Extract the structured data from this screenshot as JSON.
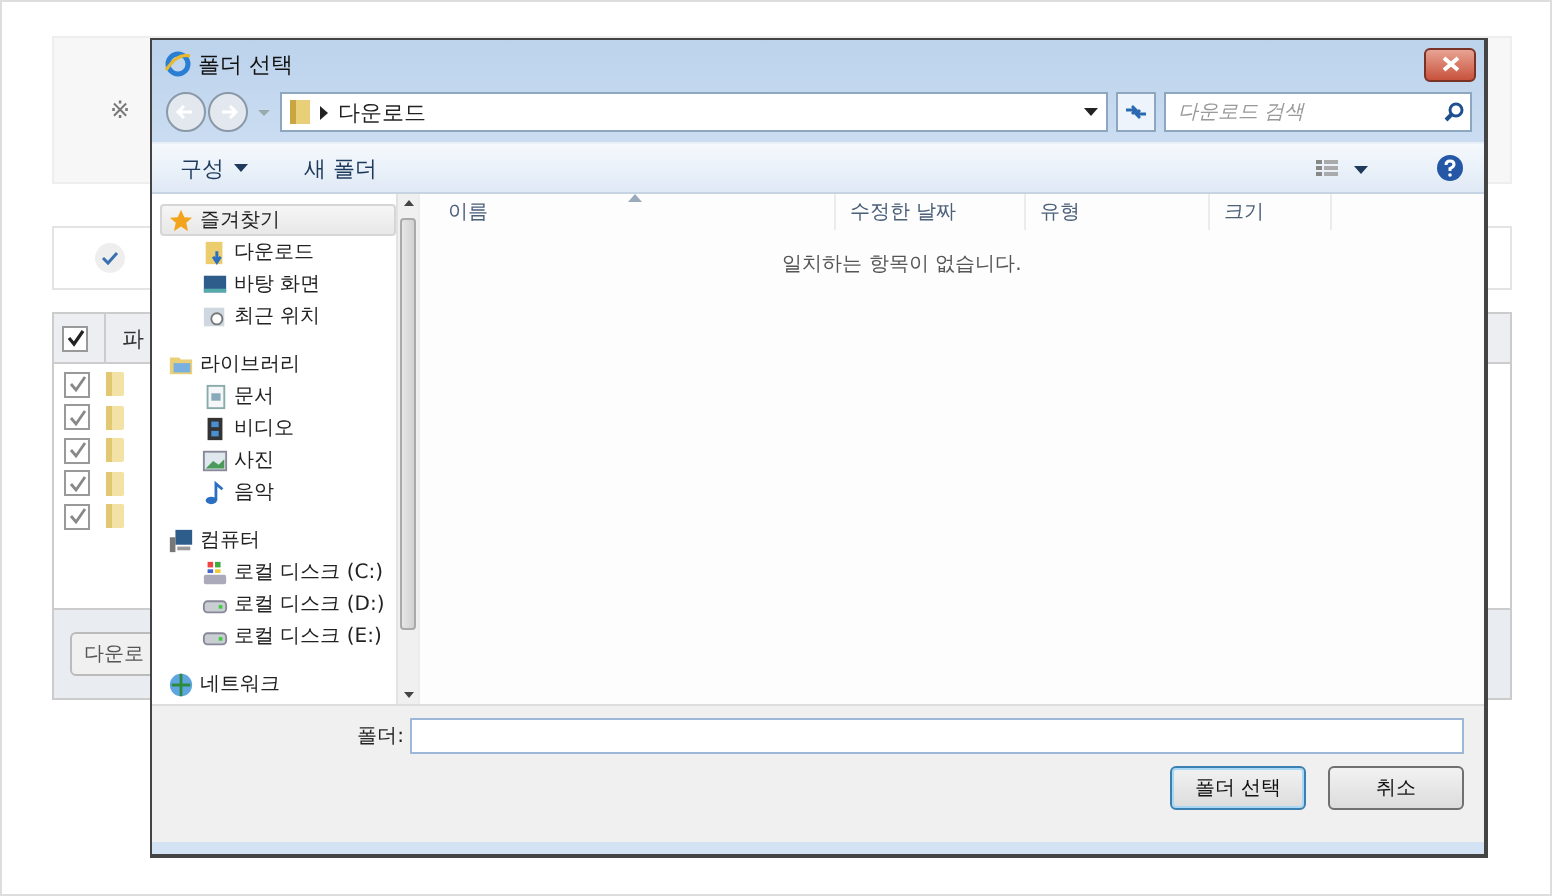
{
  "background_page": {
    "notice": "※",
    "table": {
      "header_checked": true,
      "columns": [
        "파"
      ],
      "rows": [
        {
          "checked": true
        },
        {
          "checked": true
        },
        {
          "checked": true
        },
        {
          "checked": true
        },
        {
          "checked": true
        }
      ]
    },
    "button": "다운로"
  },
  "dialog": {
    "title": "폴더 선택",
    "address": {
      "path": "다운로드"
    },
    "search": {
      "placeholder": "다운로드 검색"
    },
    "toolbar": [
      {
        "label": "구성",
        "kind": "menu"
      },
      {
        "label": "새 폴더",
        "kind": "button"
      }
    ],
    "nav": [
      {
        "label": "즐겨찾기",
        "kind": "favorites",
        "selected": true,
        "children": [
          {
            "label": "다운로드",
            "kind": "downloads",
            "selected": false
          },
          {
            "label": "바탕 화면",
            "kind": "desktop",
            "selected": false
          },
          {
            "label": "최근 위치",
            "kind": "recent",
            "selected": false
          }
        ]
      },
      {
        "label": "라이브러리",
        "kind": "library",
        "selected": false,
        "children": [
          {
            "label": "문서",
            "kind": "documents",
            "selected": false
          },
          {
            "label": "비디오",
            "kind": "video",
            "selected": false
          },
          {
            "label": "사진",
            "kind": "pictures",
            "selected": false
          },
          {
            "label": "음악",
            "kind": "music",
            "selected": false
          }
        ]
      },
      {
        "label": "컴퓨터",
        "kind": "computer",
        "selected": false,
        "children": [
          {
            "label": "로컬 디스크 (C:)",
            "kind": "system-drive",
            "selected": false
          },
          {
            "label": "로컬 디스크 (D:)",
            "kind": "drive",
            "selected": false
          },
          {
            "label": "로컬 디스크 (E:)",
            "kind": "drive",
            "selected": false
          }
        ]
      },
      {
        "label": "네트워크",
        "kind": "network",
        "selected": false
      }
    ],
    "columns": [
      {
        "label": "이름",
        "sorted": true
      },
      {
        "label": "수정한 날짜",
        "sorted": false
      },
      {
        "label": "유형",
        "sorted": false
      },
      {
        "label": "크기",
        "sorted": false
      }
    ],
    "empty_message": "일치하는 항목이 없습니다.",
    "folder_field": {
      "label": "폴더:"
    },
    "buttons": [
      {
        "label": "폴더 선택",
        "default": true
      },
      {
        "label": "취소",
        "default": false
      }
    ]
  }
}
